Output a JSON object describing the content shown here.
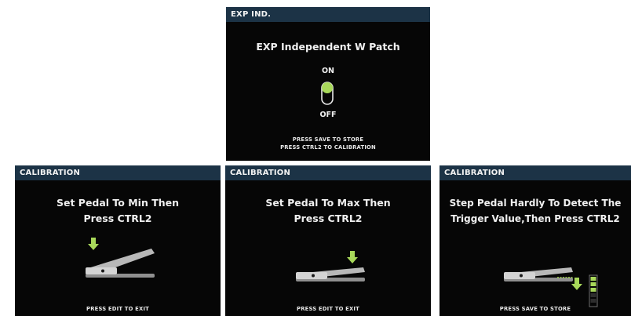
{
  "panels": {
    "exp_ind": {
      "header": "EXP IND.",
      "title": "EXP Independent W Patch",
      "on_label": "ON",
      "off_label": "OFF",
      "toggle_state": "on",
      "footer_lines": [
        "PRESS SAVE TO STORE",
        "PRESS CTRL2 TO CALIBRATION"
      ]
    },
    "cal_min": {
      "header": "CALIBRATION",
      "lines": [
        "Set Pedal To Min Then",
        "Press CTRL2"
      ],
      "footer": "PRESS EDIT TO EXIT"
    },
    "cal_max": {
      "header": "CALIBRATION",
      "lines": [
        "Set Pedal To Max Then",
        "Press CTRL2"
      ],
      "footer": "PRESS EDIT TO EXIT"
    },
    "cal_trigger": {
      "header": "CALIBRATION",
      "lines": [
        "Step Pedal Hardly To Detect The",
        "Trigger Value,Then Press CTRL2"
      ],
      "footer": "PRESS SAVE TO STORE"
    }
  },
  "colors": {
    "header_bg": "#1c3346",
    "screen_bg": "#060606",
    "accent_green": "#a8d85a",
    "pedal_gray": "#b8b8b8"
  },
  "icons": [
    "toggle-switch-icon",
    "down-arrow-icon",
    "expression-pedal-icon",
    "level-meter-icon"
  ]
}
